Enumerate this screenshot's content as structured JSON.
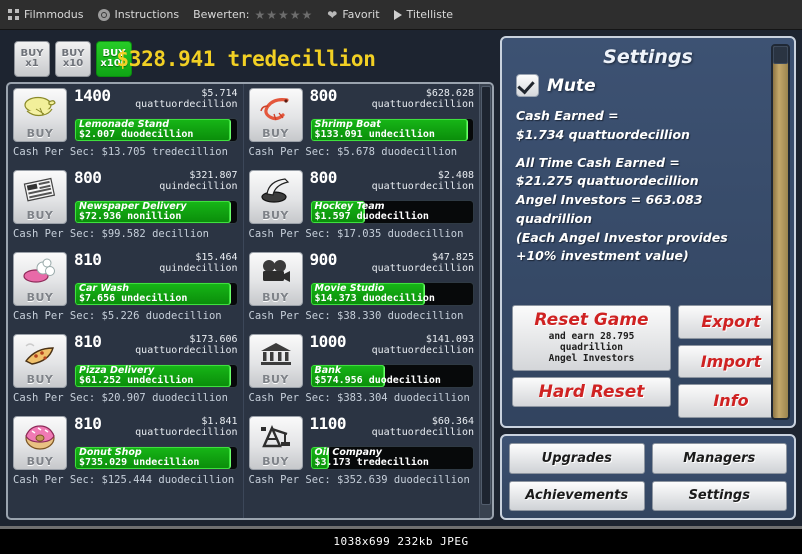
{
  "viewer": {
    "toolbar": [
      {
        "icon": "film-mode-icon",
        "label": "Filmmodus"
      },
      {
        "icon": "instructions-icon",
        "label": "Instructions"
      },
      {
        "icon": "",
        "label": "Bewerten:"
      },
      {
        "icon": "stars-icon",
        "label": "★★★★★"
      },
      {
        "icon": "heart-icon",
        "label": "Favorit"
      },
      {
        "icon": "play-icon",
        "label": "Titelliste"
      }
    ],
    "status": "1038x699  232kb  JPEG"
  },
  "game": {
    "buy_buttons": [
      {
        "top": "BUY",
        "bottom": "x1",
        "selected": false
      },
      {
        "top": "BUY",
        "bottom": "x10",
        "selected": false
      },
      {
        "top": "BUY",
        "bottom": "x100",
        "selected": true
      }
    ],
    "cash_total": "$328.941 tredecillion",
    "cash_color": "#f2d024",
    "businesses_left": [
      {
        "icon": "lemon-icon",
        "buy_label": "BUY",
        "count": "1400",
        "cost_amount": "$5.714",
        "cost_unit": "quattuordecillion",
        "name": "Lemonade Stand",
        "value": "$2.007 duodecillion",
        "progress": 96,
        "cps": "Cash Per Sec: $13.705 tredecillion"
      },
      {
        "icon": "newspaper-icon",
        "buy_label": "BUY",
        "count": "800",
        "cost_amount": "$321.807",
        "cost_unit": "quindecillion",
        "name": "Newspaper Delivery",
        "value": "$72.936 nonillion",
        "progress": 96,
        "cps": "Cash Per Sec: $99.582 decillion"
      },
      {
        "icon": "carwash-icon",
        "buy_label": "BUY",
        "count": "810",
        "cost_amount": "$15.464",
        "cost_unit": "quindecillion",
        "name": "Car Wash",
        "value": "$7.656 undecillion",
        "progress": 96,
        "cps": "Cash Per Sec: $5.226 duodecillion"
      },
      {
        "icon": "pizza-icon",
        "buy_label": "BUY",
        "count": "810",
        "cost_amount": "$173.606",
        "cost_unit": "quattuordecillion",
        "name": "Pizza Delivery",
        "value": "$61.252 undecillion",
        "progress": 96,
        "cps": "Cash Per Sec: $20.907 duodecillion"
      },
      {
        "icon": "donut-icon",
        "buy_label": "BUY",
        "count": "810",
        "cost_amount": "$1.841",
        "cost_unit": "quattuordecillion",
        "name": "Donut Shop",
        "value": "$735.029 undecillion",
        "progress": 96,
        "cps": "Cash Per Sec: $125.444 duodecillion"
      }
    ],
    "businesses_right": [
      {
        "icon": "shrimp-icon",
        "buy_label": "BUY",
        "count": "800",
        "cost_amount": "$628.628",
        "cost_unit": "quattuordecillion",
        "name": "Shrimp Boat",
        "value": "$133.091 undecillion",
        "progress": 96,
        "cps": "Cash Per Sec: $5.678 duodecillion"
      },
      {
        "icon": "hockey-icon",
        "buy_label": "BUY",
        "count": "800",
        "cost_amount": "$2.408",
        "cost_unit": "quattuordecillion",
        "name": "Hockey Team",
        "value": "$1.597 duodecillion",
        "progress": 33,
        "cps": "Cash Per Sec: $17.035 duodecillion"
      },
      {
        "icon": "movie-camera-icon",
        "buy_label": "BUY",
        "count": "900",
        "cost_amount": "$47.825",
        "cost_unit": "quattuordecillion",
        "name": "Movie Studio",
        "value": "$14.373 duodecillion",
        "progress": 70,
        "cps": "Cash Per Sec: $38.330 duodecillion"
      },
      {
        "icon": "bank-icon",
        "buy_label": "BUY",
        "count": "1000",
        "cost_amount": "$141.093",
        "cost_unit": "quattuordecillion",
        "name": "Bank",
        "value": "$574.956 duodecillion",
        "progress": 45,
        "cps": "Cash Per Sec: $383.304 duodecillion"
      },
      {
        "icon": "oil-pump-icon",
        "buy_label": "BUY",
        "count": "1100",
        "cost_amount": "$60.364",
        "cost_unit": "quattuordecillion",
        "name": "Oil Company",
        "value": "$3.173 tredecillion",
        "progress": 11,
        "cps": "Cash Per Sec: $352.639 duodecillion"
      }
    ],
    "settings": {
      "title": "Settings",
      "mute_label": "Mute",
      "mute_checked": true,
      "stat_lines": [
        "Cash Earned =",
        "$1.734 quattuordecillion",
        "",
        "All Time Cash Earned =",
        "$21.275 quattuordecillion",
        "Angel Investors = 663.083",
        "quadrillion",
        "(Each Angel Investor provides",
        "+10% investment value)"
      ],
      "reset_game_label": "Reset Game",
      "reset_game_sub": "and earn 28.795\nquadrillion\nAngel Investors",
      "hard_reset_label": "Hard Reset",
      "export_label": "Export",
      "import_label": "Import",
      "info_label": "Info",
      "button_text_color": "#cf2222"
    },
    "nav_buttons": [
      "Upgrades",
      "Managers",
      "Achievements",
      "Settings"
    ]
  }
}
